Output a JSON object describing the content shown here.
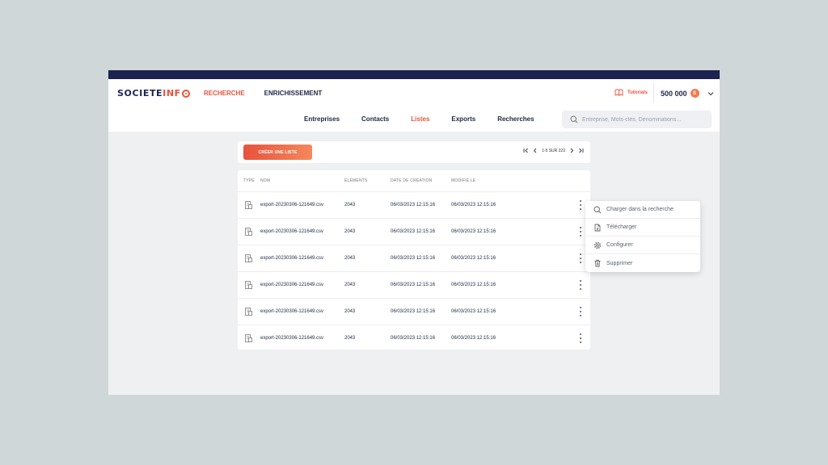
{
  "brand": {
    "logo_main": "SOCIETE",
    "logo_accent": "INF"
  },
  "main_nav": [
    {
      "label": "RECHERCHE",
      "active": true
    },
    {
      "label": "ENRICHISSEMENT",
      "active": false
    }
  ],
  "tutorials": {
    "label": "Tutorials",
    "icon": "book-icon"
  },
  "credits": {
    "amount": "500 000",
    "coin_label": "S"
  },
  "sub_nav": [
    {
      "label": "Entreprises",
      "active": false
    },
    {
      "label": "Contacts",
      "active": false
    },
    {
      "label": "Listes",
      "active": true
    },
    {
      "label": "Exports",
      "active": false
    },
    {
      "label": "Recherches",
      "active": false
    }
  ],
  "search": {
    "placeholder": "Entreprise, Mots-clés, Dénominations..."
  },
  "toolbar": {
    "create_label": "CRÉER UNE LISTE",
    "pagination": "1-5 SUR 223"
  },
  "table": {
    "columns": [
      "TYPE",
      "NOM",
      "ÉLÉMENTS",
      "DATE DE CRÉATION",
      "MODIFIÉ LE"
    ],
    "rows": [
      {
        "name": "export-20230306-121649.csv",
        "elements": "2043",
        "created": "06/03/2023 12:15:16",
        "modified": "06/03/2023 12:15:16"
      },
      {
        "name": "export-20230306-121649.csv",
        "elements": "2043",
        "created": "06/03/2023 12:15:16",
        "modified": "06/03/2023 12:15:16"
      },
      {
        "name": "export-20230306-121649.csv",
        "elements": "2043",
        "created": "06/03/2023 12:15:16",
        "modified": "06/03/2023 12:15:16"
      },
      {
        "name": "export-20230306-121649.csv",
        "elements": "2043",
        "created": "06/03/2023 12:15:16",
        "modified": "06/03/2023 12:15:16"
      },
      {
        "name": "export-20230306-121649.csv",
        "elements": "2043",
        "created": "06/03/2023 12:15:16",
        "modified": "06/03/2023 12:15:16"
      },
      {
        "name": "export-20230306-121649.csv",
        "elements": "2043",
        "created": "06/03/2023 12:15:16",
        "modified": "06/03/2023 12:15:16"
      }
    ]
  },
  "context_menu": [
    {
      "label": "Charger dans la recherche",
      "icon": "search-icon"
    },
    {
      "label": "Télécharger",
      "icon": "file-download-icon"
    },
    {
      "label": "Configurer",
      "icon": "gear-icon"
    },
    {
      "label": "Supprimer",
      "icon": "trash-icon"
    }
  ],
  "colors": {
    "accent": "#e8523c",
    "navy": "#1c2350",
    "background": "#cfd7d8"
  }
}
